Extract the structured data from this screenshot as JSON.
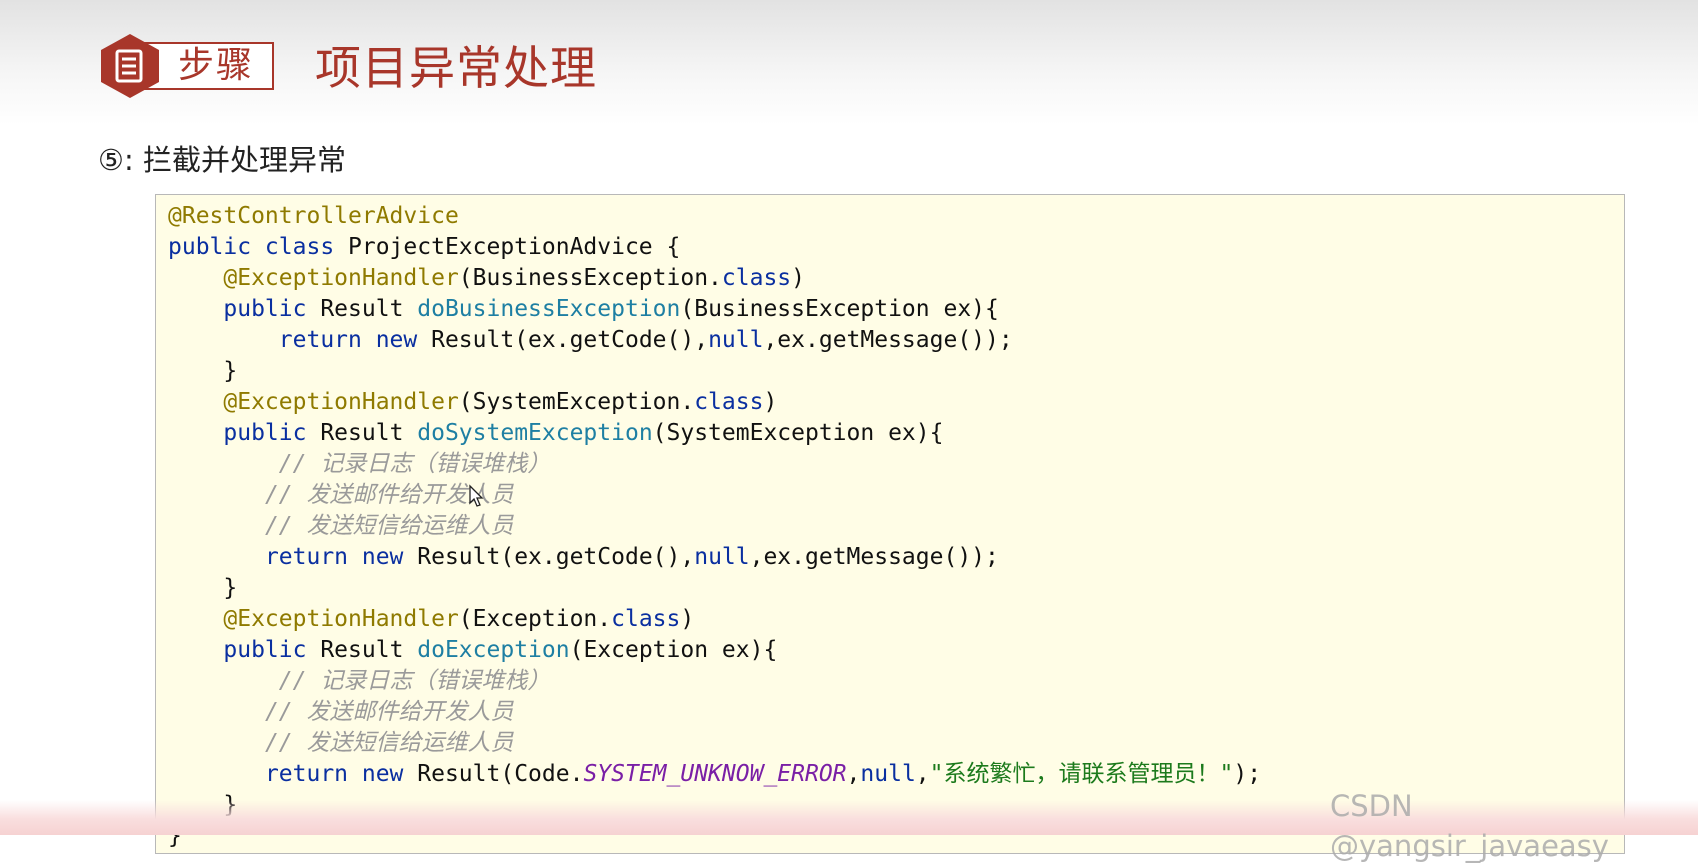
{
  "header": {
    "badge_label": "步骤",
    "title": "项目异常处理"
  },
  "step": {
    "label": "⑤: 拦截并处理异常"
  },
  "code": {
    "lines": [
      [
        {
          "t": "@RestControllerAdvice",
          "c": "ann"
        }
      ],
      [
        {
          "t": "public class ",
          "c": "kw"
        },
        {
          "t": "ProjectExceptionAdvice {",
          "c": ""
        }
      ],
      [
        {
          "t": "    ",
          "c": ""
        },
        {
          "t": "@ExceptionHandler",
          "c": "ann"
        },
        {
          "t": "(BusinessException.",
          "c": ""
        },
        {
          "t": "class",
          "c": "kw"
        },
        {
          "t": ")",
          "c": ""
        }
      ],
      [
        {
          "t": "    ",
          "c": ""
        },
        {
          "t": "public ",
          "c": "kw"
        },
        {
          "t": "Result ",
          "c": ""
        },
        {
          "t": "doBusinessException",
          "c": "mth"
        },
        {
          "t": "(BusinessException ex){",
          "c": ""
        }
      ],
      [
        {
          "t": "        ",
          "c": ""
        },
        {
          "t": "return new ",
          "c": "kw"
        },
        {
          "t": "Result(ex.getCode(),",
          "c": ""
        },
        {
          "t": "null",
          "c": "kw"
        },
        {
          "t": ",ex.getMessage());",
          "c": ""
        }
      ],
      [
        {
          "t": "    }",
          "c": ""
        }
      ],
      [
        {
          "t": "    ",
          "c": ""
        },
        {
          "t": "@ExceptionHandler",
          "c": "ann"
        },
        {
          "t": "(SystemException.",
          "c": ""
        },
        {
          "t": "class",
          "c": "kw"
        },
        {
          "t": ")",
          "c": ""
        }
      ],
      [
        {
          "t": "    ",
          "c": ""
        },
        {
          "t": "public ",
          "c": "kw"
        },
        {
          "t": "Result ",
          "c": ""
        },
        {
          "t": "doSystemException",
          "c": "mth"
        },
        {
          "t": "(SystemException ex){",
          "c": ""
        }
      ],
      [
        {
          "t": "        ",
          "c": ""
        },
        {
          "t": "// 记录日志（错误堆栈）",
          "c": "cmt"
        }
      ],
      [
        {
          "t": "       ",
          "c": ""
        },
        {
          "t": "// 发送邮件给开发人员",
          "c": "cmt"
        }
      ],
      [
        {
          "t": "       ",
          "c": ""
        },
        {
          "t": "// 发送短信给运维人员",
          "c": "cmt"
        }
      ],
      [
        {
          "t": "       ",
          "c": ""
        },
        {
          "t": "return new ",
          "c": "kw"
        },
        {
          "t": "Result(ex.getCode(),",
          "c": ""
        },
        {
          "t": "null",
          "c": "kw"
        },
        {
          "t": ",ex.getMessage());",
          "c": ""
        }
      ],
      [
        {
          "t": "    }",
          "c": ""
        }
      ],
      [
        {
          "t": "    ",
          "c": ""
        },
        {
          "t": "@ExceptionHandler",
          "c": "ann"
        },
        {
          "t": "(Exception.",
          "c": ""
        },
        {
          "t": "class",
          "c": "kw"
        },
        {
          "t": ")",
          "c": ""
        }
      ],
      [
        {
          "t": "    ",
          "c": ""
        },
        {
          "t": "public ",
          "c": "kw"
        },
        {
          "t": "Result ",
          "c": ""
        },
        {
          "t": "doException",
          "c": "mth"
        },
        {
          "t": "(Exception ex){",
          "c": ""
        }
      ],
      [
        {
          "t": "        ",
          "c": ""
        },
        {
          "t": "// 记录日志（错误堆栈）",
          "c": "cmt"
        }
      ],
      [
        {
          "t": "       ",
          "c": ""
        },
        {
          "t": "// 发送邮件给开发人员",
          "c": "cmt"
        }
      ],
      [
        {
          "t": "       ",
          "c": ""
        },
        {
          "t": "// 发送短信给运维人员",
          "c": "cmt"
        }
      ],
      [
        {
          "t": "       ",
          "c": ""
        },
        {
          "t": "return new ",
          "c": "kw"
        },
        {
          "t": "Result(Code.",
          "c": ""
        },
        {
          "t": "SYSTEM_UNKNOW_ERROR",
          "c": "cst"
        },
        {
          "t": ",",
          "c": ""
        },
        {
          "t": "null",
          "c": "kw"
        },
        {
          "t": ",",
          "c": ""
        },
        {
          "t": "\"系统繁忙，请联系管理员！\"",
          "c": "str"
        },
        {
          "t": ");",
          "c": ""
        }
      ],
      [
        {
          "t": "    }",
          "c": ""
        }
      ],
      [
        {
          "t": "}",
          "c": ""
        }
      ]
    ]
  },
  "watermark": "CSDN @yangsir_javaeasy",
  "colors": {
    "accent": "#a8362a",
    "code_background": "#fffde6",
    "annotation": "#8f7a00",
    "keyword": "#0a2fa0",
    "method": "#1e7fa3",
    "comment": "#9a9a9a",
    "constant": "#7a1fa6",
    "string": "#1c7a1c"
  },
  "icons": {
    "badge": "document-icon",
    "cursor": "mouse-cursor-icon"
  }
}
